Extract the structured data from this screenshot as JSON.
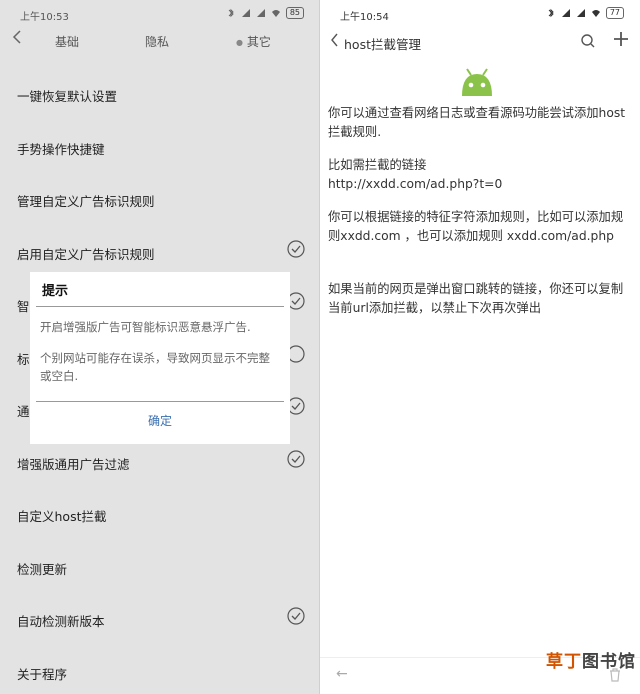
{
  "left": {
    "status": {
      "time": "上午10:53",
      "battery": "85"
    },
    "tabs": {
      "basic": "基础",
      "privacy": "隐私",
      "other": "其它"
    },
    "menu": [
      {
        "label": "一键恢复默认设置",
        "checked": false
      },
      {
        "label": "手势操作快捷键",
        "checked": false
      },
      {
        "label": "管理自定义广告标识规则",
        "checked": false
      },
      {
        "label": "启用自定义广告标识规则",
        "checked": true
      },
      {
        "label": "智",
        "checked": true
      },
      {
        "label": "标",
        "checked": false
      },
      {
        "label": "通",
        "checked": true
      },
      {
        "label": "增强版通用广告过滤",
        "checked": true
      },
      {
        "label": "自定义host拦截",
        "checked": false
      },
      {
        "label": "检测更新",
        "checked": false
      },
      {
        "label": "自动检测新版本",
        "checked": true
      },
      {
        "label": "关于程序",
        "checked": false
      }
    ],
    "dialog": {
      "title": "提示",
      "body1": "开启增强版广告可智能标识恶意悬浮广告.",
      "body2": "个别网站可能存在误杀，导致网页显示不完整或空白.",
      "confirm": "确定"
    }
  },
  "right": {
    "status": {
      "time": "上午10:54",
      "battery": "77"
    },
    "toolbar": {
      "title": "host拦截管理"
    },
    "content": {
      "p1": "你可以通过查看网络日志或查看源码功能尝试添加host拦截规则.",
      "p2a": "比如需拦截的链接",
      "p2b": "http://xxdd.com/ad.php?t=0",
      "p3": "你可以根据链接的特征字符添加规则，比如可以添加规则xxdd.com ，也可以添加规则 xxdd.com/ad.php",
      "p4": "如果当前的网页是弹出窗口跳转的链接，你还可以复制当前url添加拦截，以禁止下次再次弹出"
    }
  },
  "watermark": {
    "part1": "草丁",
    "part2": "图书馆"
  },
  "colors": {
    "left_bg": "#e3e3e3",
    "accent": "#3a6fb0",
    "android_green": "#8bc34a"
  }
}
